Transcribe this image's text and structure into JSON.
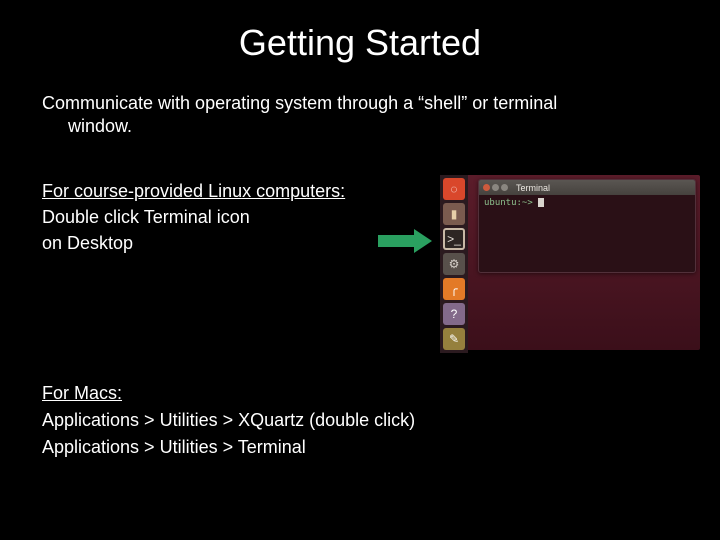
{
  "title": "Getting Started",
  "subtitle_line1": "Communicate with operating system through a “shell” or terminal",
  "subtitle_line2": "window.",
  "section_linux": {
    "heading": "For course-provided Linux computers:",
    "line1": "Double click Terminal icon",
    "line2": "on Desktop"
  },
  "section_mac": {
    "heading": "For Macs:",
    "line1": "Applications > Utilities > XQuartz (double click)",
    "line2": "Applications > Utilities > Terminal"
  },
  "screenshot": {
    "window_title": "Terminal",
    "prompt_host": "ubuntu:~>",
    "launcher_icons": [
      "dash",
      "files",
      "term",
      "gear",
      "fox",
      "quest",
      "hint"
    ]
  }
}
